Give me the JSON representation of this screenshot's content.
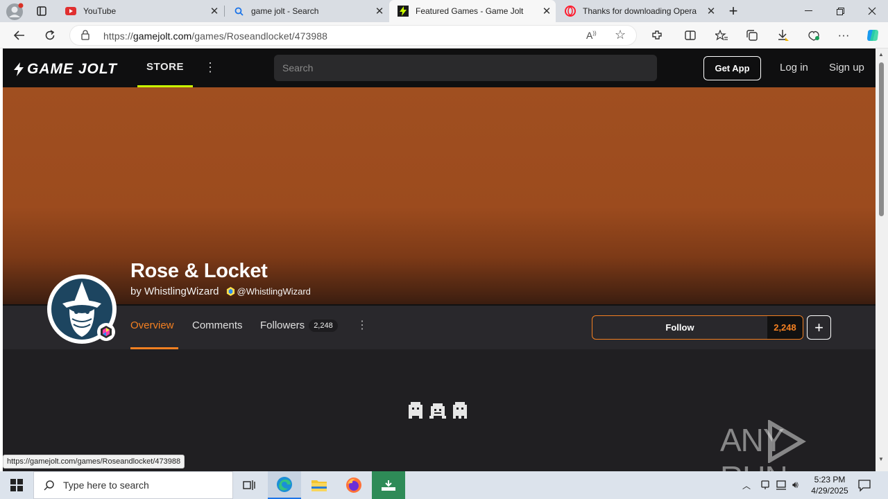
{
  "browser": {
    "tabs": [
      {
        "title": "YouTube",
        "icon": "youtube-icon"
      },
      {
        "title": "game jolt - Search",
        "icon": "search-icon"
      },
      {
        "title": "Featured Games - Game Jolt",
        "icon": "gamejolt-icon",
        "active": true
      },
      {
        "title": "Thanks for downloading Opera",
        "icon": "opera-icon"
      }
    ],
    "url_prefix": "https://",
    "url_domain": "gamejolt.com",
    "url_path": "/games/Roseandlocket/473988",
    "status_url": "https://gamejolt.com/games/Roseandlocket/473988"
  },
  "site": {
    "logo": "GAME JOLT",
    "store": "STORE",
    "search_placeholder": "Search",
    "get_app": "Get App",
    "login": "Log in",
    "signup": "Sign up"
  },
  "game": {
    "title": "Rose & Locket",
    "by": "by WhistlingWizard",
    "handle": "@WhistlingWizard",
    "tabs": {
      "overview": "Overview",
      "comments": "Comments",
      "followers": "Followers",
      "followers_count": "2,248"
    },
    "follow_label": "Follow",
    "follow_count": "2,248"
  },
  "watermark": "ANY RUN",
  "taskbar": {
    "search_placeholder": "Type here to search",
    "time": "5:23 PM",
    "date": "4/29/2025"
  },
  "colors": {
    "accent_orange": "#f48021",
    "store_underline": "#ccff00",
    "banner": "#a04f20"
  }
}
